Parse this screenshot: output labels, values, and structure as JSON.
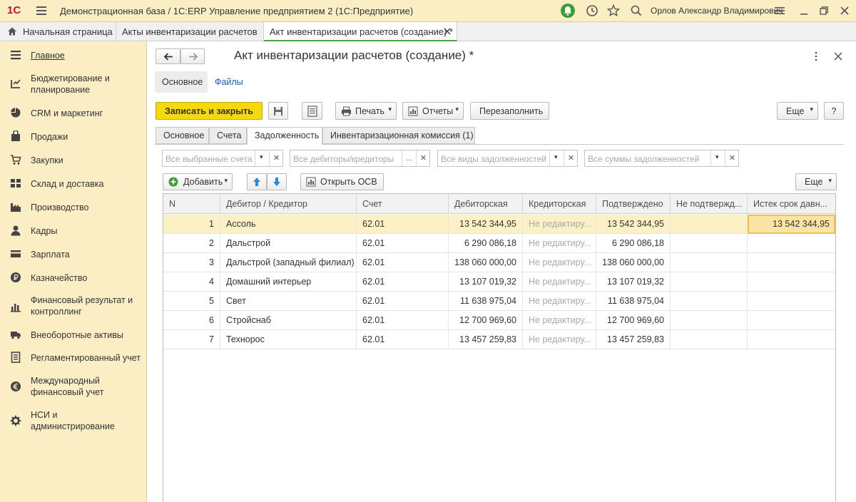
{
  "titlebar": {
    "logo": "1С",
    "title": "Демонстрационная база / 1С:ERP Управление предприятием 2  (1С:Предприятие)",
    "user": "Орлов Александр Владимирович"
  },
  "window_tabs": [
    {
      "label": "Начальная страница"
    },
    {
      "label": "Акты инвентаризации расчетов"
    },
    {
      "label": "Акт инвентаризации расчетов (создание) *"
    }
  ],
  "sidebar": {
    "items": [
      {
        "label": "Главное",
        "icon": "menu-icon"
      },
      {
        "label": "Бюджетирование и планирование",
        "icon": "budget-icon"
      },
      {
        "label": "CRM и маркетинг",
        "icon": "pie-icon"
      },
      {
        "label": "Продажи",
        "icon": "bag-icon"
      },
      {
        "label": "Закупки",
        "icon": "cart-icon"
      },
      {
        "label": "Склад и доставка",
        "icon": "warehouse-icon"
      },
      {
        "label": "Производство",
        "icon": "factory-icon"
      },
      {
        "label": "Кадры",
        "icon": "person-icon"
      },
      {
        "label": "Зарплата",
        "icon": "salary-icon"
      },
      {
        "label": "Казначейство",
        "icon": "ruble-icon"
      },
      {
        "label": "Финансовый результат и контроллинг",
        "icon": "chart-icon"
      },
      {
        "label": "Внеоборотные активы",
        "icon": "truck-icon"
      },
      {
        "label": "Регламентированный учет",
        "icon": "document-icon"
      },
      {
        "label": "Международный финансовый учет",
        "icon": "euro-icon"
      },
      {
        "label": "НСИ и администрирование",
        "icon": "gear-icon"
      }
    ]
  },
  "form": {
    "title": "Акт инвентаризации расчетов (создание) *",
    "section_tabs": [
      "Основное",
      "Файлы"
    ],
    "toolbar": {
      "save_close": "Записать и закрыть",
      "print": "Печать",
      "reports": "Отчеты",
      "refill": "Перезаполнить",
      "more": "Еще",
      "help": "?"
    },
    "subtabs": [
      "Основное",
      "Счета",
      "Задолженность",
      "Инвентаризационная комиссия (1)"
    ],
    "filters": [
      {
        "placeholder": "Все выбранные счета"
      },
      {
        "placeholder": "Все дебиторы/кредиторы",
        "select": "..."
      },
      {
        "placeholder": "Все виды задолженностей"
      },
      {
        "placeholder": "Все суммы задолженностей"
      }
    ],
    "table_toolbar": {
      "add": "Добавить",
      "open_osv": "Открыть ОСВ",
      "more": "Еще"
    },
    "table": {
      "columns": [
        "N",
        "Дебитор / Кредитор",
        "Счет",
        "Дебиторская",
        "Кредиторская",
        "Подтверждено",
        "Не подтвержд...",
        "Истек срок давн..."
      ],
      "rows": [
        {
          "n": "1",
          "party": "Ассоль",
          "account": "62.01",
          "debit": "13 542 344,95",
          "credit": "Не редактиру...",
          "confirmed": "13 542 344,95",
          "unconfirmed": "",
          "expired": "13 542 344,95"
        },
        {
          "n": "2",
          "party": "Дальстрой",
          "account": "62.01",
          "debit": "6 290 086,18",
          "credit": "Не редактиру...",
          "confirmed": "6 290 086,18",
          "unconfirmed": "",
          "expired": ""
        },
        {
          "n": "3",
          "party": "Дальстрой (западный филиал)",
          "account": "62.01",
          "debit": "138 060 000,00",
          "credit": "Не редактиру...",
          "confirmed": "138 060 000,00",
          "unconfirmed": "",
          "expired": ""
        },
        {
          "n": "4",
          "party": "Домашний интерьер",
          "account": "62.01",
          "debit": "13 107 019,32",
          "credit": "Не редактиру...",
          "confirmed": "13 107 019,32",
          "unconfirmed": "",
          "expired": ""
        },
        {
          "n": "5",
          "party": "Свет",
          "account": "62.01",
          "debit": "11 638 975,04",
          "credit": "Не редактиру...",
          "confirmed": "11 638 975,04",
          "unconfirmed": "",
          "expired": ""
        },
        {
          "n": "6",
          "party": "Стройснаб",
          "account": "62.01",
          "debit": "12 700 969,60",
          "credit": "Не редактиру...",
          "confirmed": "12 700 969,60",
          "unconfirmed": "",
          "expired": ""
        },
        {
          "n": "7",
          "party": "Технорос",
          "account": "62.01",
          "debit": "13 457 259,83",
          "credit": "Не редактиру...",
          "confirmed": "13 457 259,83",
          "unconfirmed": "",
          "expired": ""
        }
      ]
    }
  },
  "colors": {
    "sidebar_bg": "#fbeec5",
    "primary_button": "#f5d80e",
    "selected_row": "#fbf1c4",
    "active_tab_accent": "#4aa24a",
    "link": "#1b5fb3"
  }
}
